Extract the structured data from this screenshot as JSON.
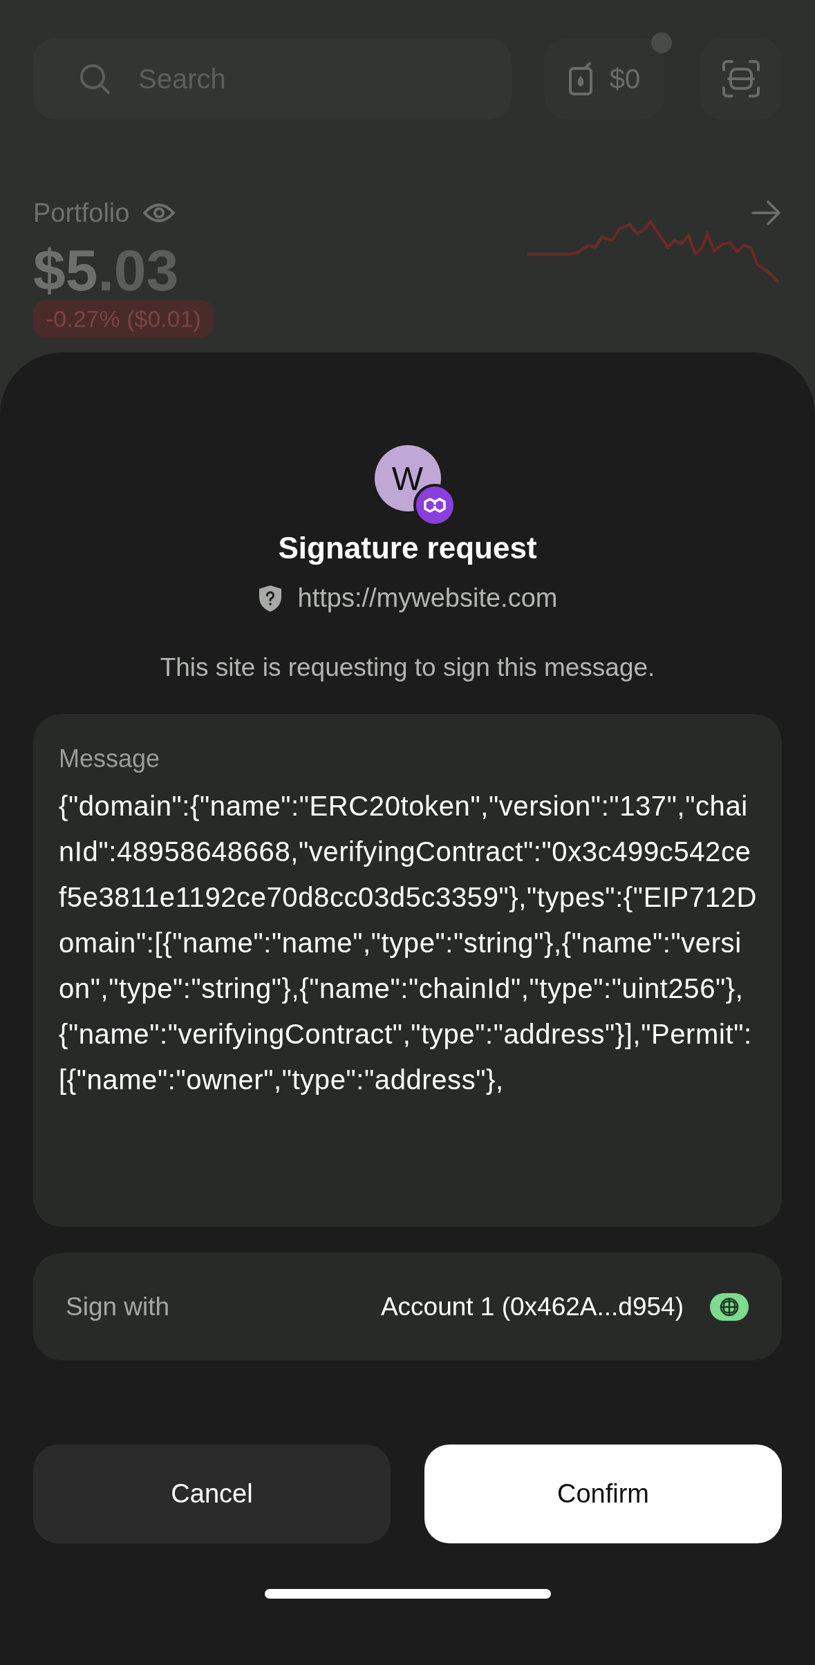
{
  "header": {
    "search": {
      "placeholder": "Search"
    },
    "gas": {
      "label": "$0"
    }
  },
  "portfolio": {
    "label": "Portfolio",
    "whole": "$5",
    "fraction": ".03",
    "change": "-0.27% ($0.01)"
  },
  "sheet": {
    "site_initial": "W",
    "title": "Signature request",
    "url": "https://mywebsite.com",
    "description": "This site is requesting to sign this message.",
    "message": {
      "label": "Message",
      "text": "{\"domain\":{\"name\":\"ERC20token\",\"version\":\"137\",\"chainId\":48958648668,\"verifyingContract\":\"0x3c499c542cef5e3811e1192ce70d8cc03d5c3359\"},\"types\":{\"EIP712Domain\":[{\"name\":\"name\",\"type\":\"string\"},{\"name\":\"version\",\"type\":\"string\"},{\"name\":\"chainId\",\"type\":\"uint256\"},{\"name\":\"verifyingContract\",\"type\":\"address\"}],\"Permit\":[{\"name\":\"owner\",\"type\":\"address\"},"
    },
    "sign_with": {
      "label": "Sign with",
      "account": "Account 1 (0x462A...d954)"
    },
    "buttons": [
      {
        "label": "Cancel",
        "kind": "secondary"
      },
      {
        "label": "Confirm",
        "kind": "primary"
      }
    ]
  }
}
